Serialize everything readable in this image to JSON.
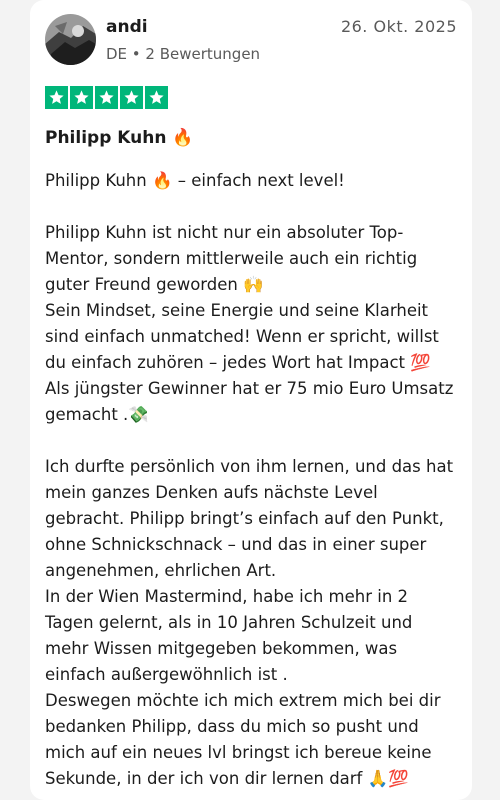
{
  "review": {
    "username": "andi",
    "meta": "DE • 2 Bewertungen",
    "date": "26. Okt. 2025",
    "rating": 5,
    "title": "Philipp Kuhn 🔥",
    "body": "Philipp Kuhn 🔥 – einfach next level!\n\nPhilipp Kuhn ist nicht nur ein absoluter Top-Mentor, sondern mittlerweile auch ein richtig guter Freund geworden 🙌\nSein Mindset, seine Energie und seine Klarheit sind einfach unmatched! Wenn er spricht, willst du einfach zuhören – jedes Wort hat Impact 💯\nAls jüngster Gewinner hat er 75 mio Euro Umsatz gemacht .💸\n\nIch durfte persönlich von ihm lernen, und das hat mein ganzes Denken aufs nächste Level gebracht. Philipp bringt’s einfach auf den Punkt, ohne Schnickschnack – und das in einer super angenehmen, ehrlichen Art.\nIn der Wien Mastermind, habe ich mehr in 2 Tagen gelernt, als in 10 Jahren Schulzeit und mehr Wissen mitgegeben bekommen, was einfach außergewöhnlich ist .\nDeswegen möchte ich mich extrem mich bei dir bedanken Philipp, dass du mich so pusht und mich auf ein neues lvl bringst ich bereue keine Sekunde, in der ich von dir lernen darf 🙏💯"
  },
  "icons": {
    "star": "star-icon",
    "avatar": "avatar-image"
  },
  "colors": {
    "star_green": "#00b67a",
    "text": "#1c1c1c",
    "muted": "#5a5a5a"
  }
}
